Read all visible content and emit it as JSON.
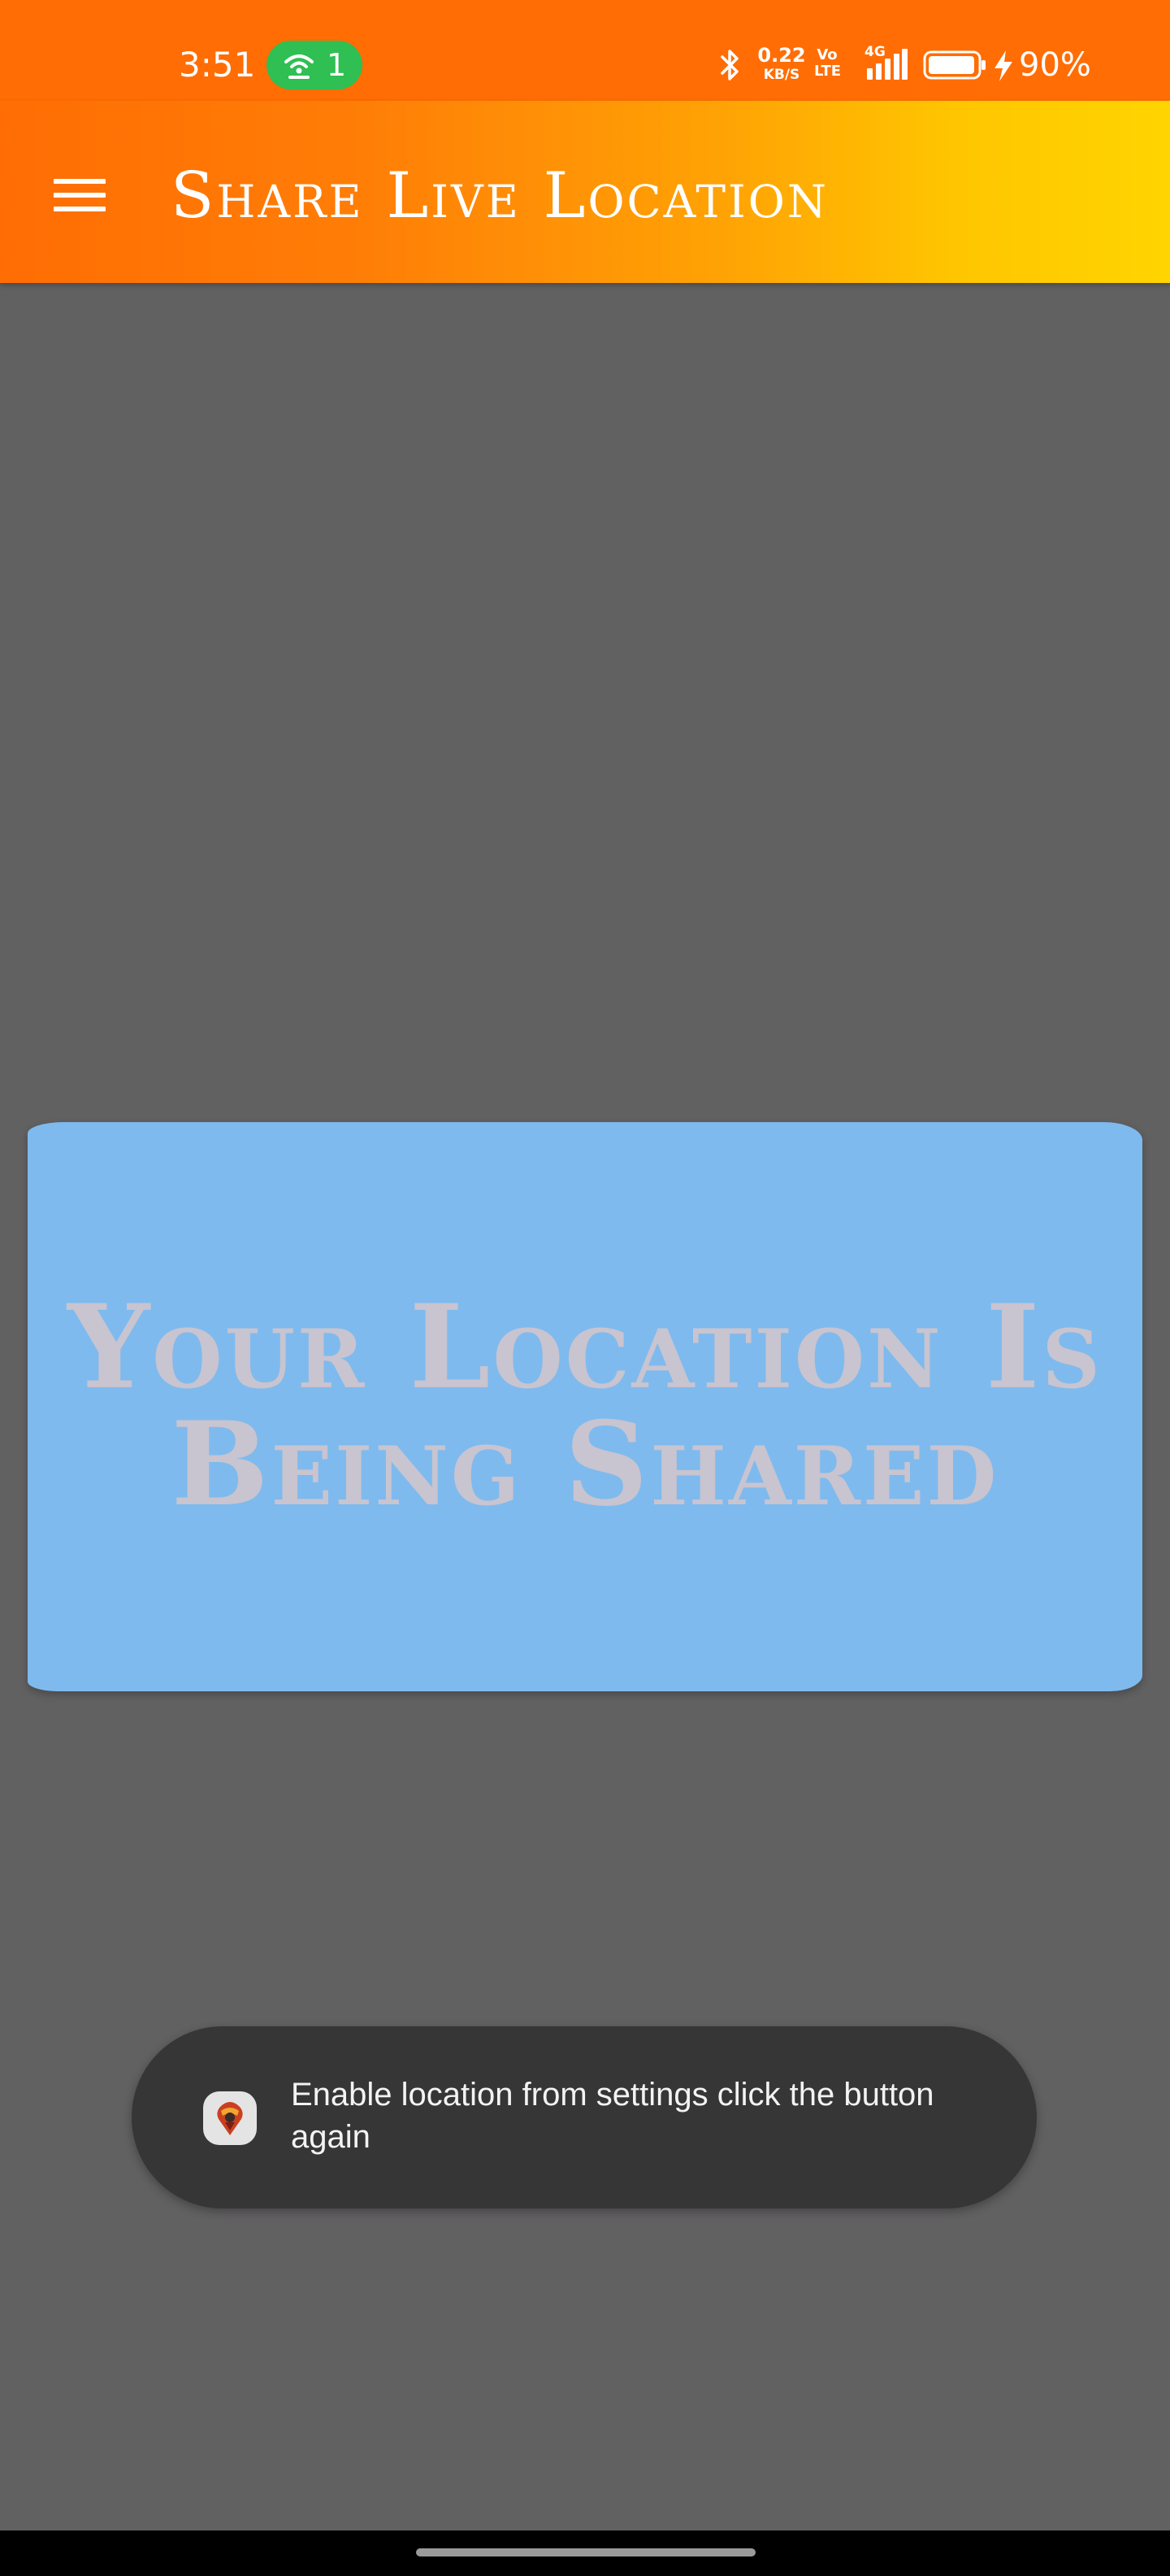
{
  "status_bar": {
    "time": "3:51",
    "hotspot_count": "1",
    "network_speed_value": "0.22",
    "network_speed_unit": "KB/S",
    "volte_top": "Vo",
    "volte_bottom": "LTE",
    "network_type": "4G",
    "battery_percent": "90%",
    "icons": [
      "hotspot-icon",
      "bluetooth-icon",
      "signal-icon",
      "battery-icon",
      "charging-icon"
    ],
    "colors": {
      "background": "#ff6d04",
      "hotspot_pill": "#2fbf52"
    }
  },
  "app_bar": {
    "title": "Share Live Location",
    "menu_icon": "hamburger-menu-icon",
    "colors": {
      "gradient_start": "#ff6d04",
      "gradient_end": "#ffd400"
    }
  },
  "card": {
    "line1": "Your Location Is",
    "line2": "Being Shared",
    "colors": {
      "background": "#7ebaee",
      "text": "#c8c4d0"
    }
  },
  "toast": {
    "message": "Enable location from settings click the button again",
    "app_icon": "app-logo-icon"
  },
  "page": {
    "colors": {
      "background": "#626162"
    }
  }
}
